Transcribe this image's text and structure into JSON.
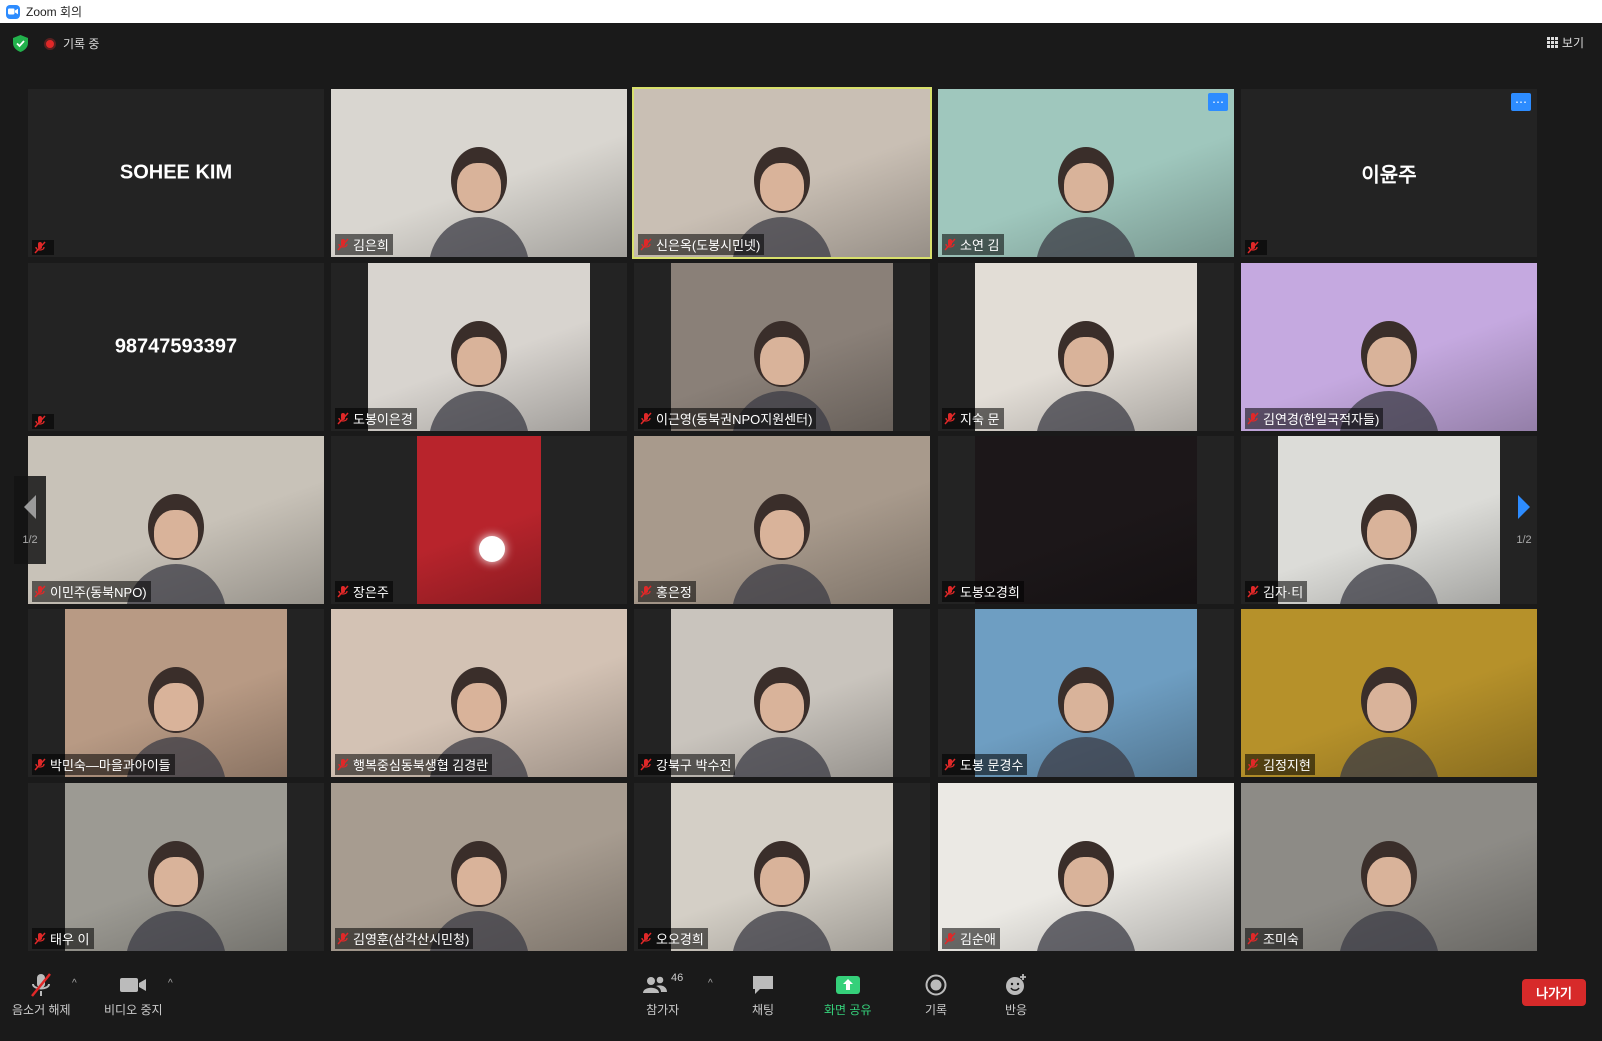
{
  "window": {
    "title": "Zoom 회의"
  },
  "topbar": {
    "recording_label": "기록 중",
    "view_label": "보기"
  },
  "pagination": {
    "left": "1/2",
    "right": "1/2"
  },
  "participants": [
    {
      "name": "SOHEE KIM",
      "video": false
    },
    {
      "name": "김은희",
      "video": true,
      "bg": "#d9d6d0"
    },
    {
      "name": "신은옥(도봉시민넷)",
      "video": true,
      "bg": "#c9bfb4",
      "active": true
    },
    {
      "name": "소연 김",
      "video": true,
      "bg": "#9fc7bd",
      "menu": true
    },
    {
      "name": "이윤주",
      "video": false,
      "menu": true
    },
    {
      "name": "98747593397",
      "video": false
    },
    {
      "name": "도봉이은경",
      "video": true,
      "bg": "#d8d4cf"
    },
    {
      "name": "이근영(동북권NPO지원센터)",
      "video": true,
      "bg": "#8a8078"
    },
    {
      "name": "지숙 문",
      "video": true,
      "bg": "#e2ddd6"
    },
    {
      "name": "김연경(한일국적자들)",
      "video": true,
      "bg": "#c5a9e0"
    },
    {
      "name": "이민주(동북NPO)",
      "video": true,
      "bg": "#c8c2b8"
    },
    {
      "name": "장은주",
      "video": true,
      "bg": "#b8242c"
    },
    {
      "name": "홍은정",
      "video": true,
      "bg": "#a89a8c"
    },
    {
      "name": "도봉오경희",
      "video": true,
      "bg": "#1c1719"
    },
    {
      "name": "김자·티",
      "video": true,
      "bg": "#dcdcd8"
    },
    {
      "name": "박민숙—마을과아이들",
      "video": true,
      "bg": "#b89a84"
    },
    {
      "name": "행복중심동북생협 김경란",
      "video": true,
      "bg": "#d3c2b4"
    },
    {
      "name": "강북구 박수진",
      "video": true,
      "bg": "#c9c4bd"
    },
    {
      "name": "도봉 문경수",
      "video": true,
      "bg": "#6e9ec2"
    },
    {
      "name": "김정지현",
      "video": true,
      "bg": "#b6912a"
    },
    {
      "name": "태우 이",
      "video": true,
      "bg": "#9c9a93"
    },
    {
      "name": "김영훈(삼각산시민청)",
      "video": true,
      "bg": "#a79c90"
    },
    {
      "name": "오오경희",
      "video": true,
      "bg": "#d4cfc6"
    },
    {
      "name": "김순애",
      "video": true,
      "bg": "#ebe9e4"
    },
    {
      "name": "조미숙",
      "video": true,
      "bg": "#8d8b86"
    }
  ],
  "controls": {
    "mute": "음소거 해제",
    "video": "비디오 중지",
    "participants": "참가자",
    "participants_count": "46",
    "chat": "채팅",
    "share": "화면 공유",
    "record": "기록",
    "reactions": "반응",
    "leave": "나가기"
  },
  "colors": {
    "accent": "#2d8cff",
    "share": "#35d07a",
    "leave": "#d72a2a",
    "active_speaker": "#d8e06c"
  }
}
